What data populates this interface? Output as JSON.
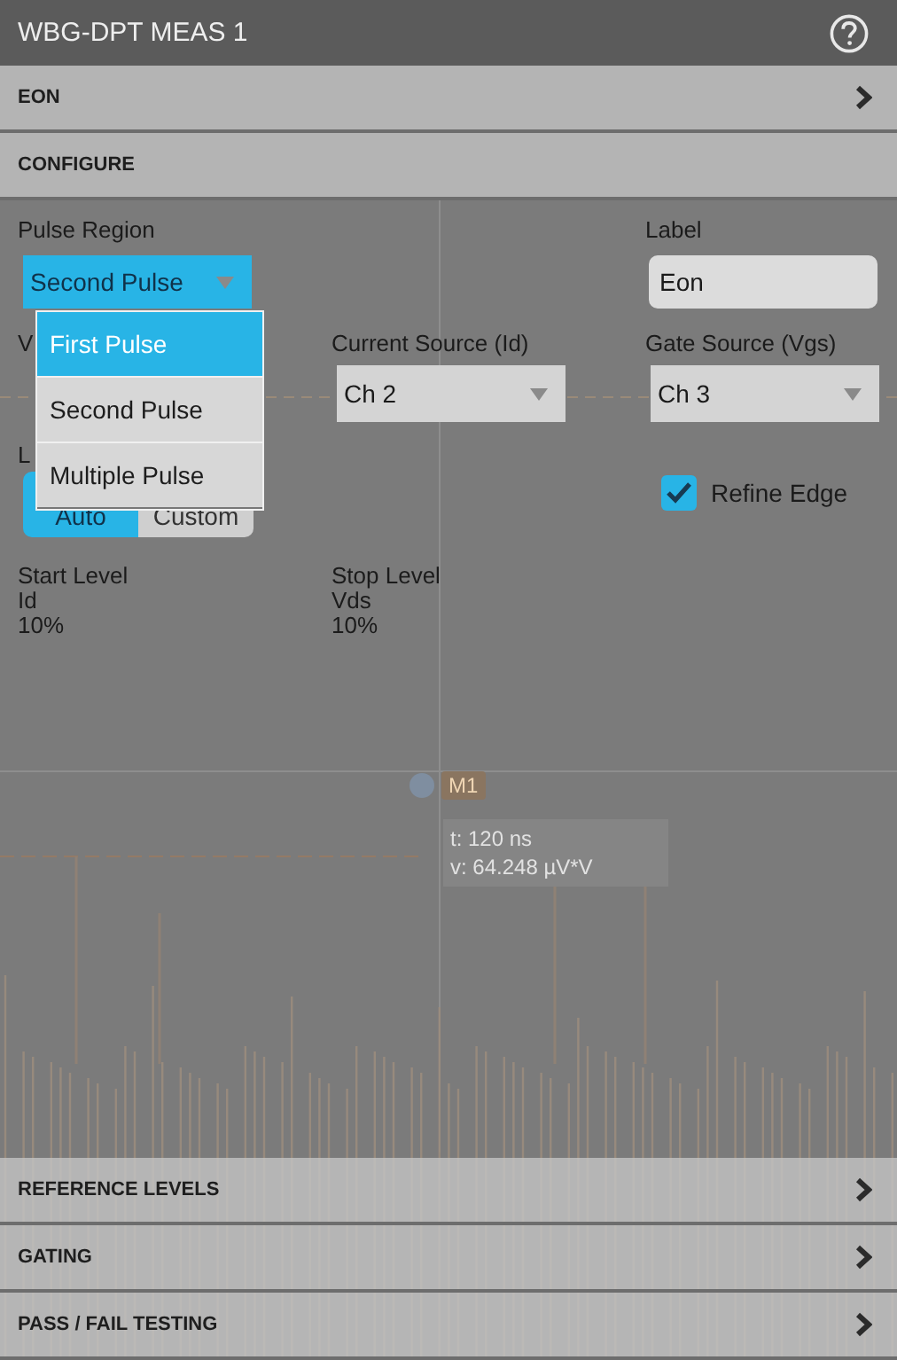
{
  "window": {
    "title": "WBG-DPT MEAS 1"
  },
  "sections_top": [
    {
      "label": "EON",
      "expanded": false
    },
    {
      "label": "CONFIGURE",
      "expanded": true
    }
  ],
  "configure": {
    "pulse_region": {
      "label": "Pulse Region",
      "value": "Second Pulse",
      "open": true,
      "options": [
        {
          "label": "First Pulse",
          "highlighted": true
        },
        {
          "label": "Second Pulse",
          "highlighted": false
        },
        {
          "label": "Multiple Pulse",
          "highlighted": false
        }
      ]
    },
    "label_field": {
      "label": "Label",
      "value": "Eon"
    },
    "voltage_source": {
      "label": "V"
    },
    "current_source": {
      "label": "Current Source (Id)",
      "value": "Ch 2",
      "open": false
    },
    "gate_source": {
      "label": "Gate Source (Vgs)",
      "value": "Ch 3",
      "open": false
    },
    "level_mode": {
      "label": "L",
      "options": [
        {
          "label": "Auto",
          "selected": true
        },
        {
          "label": "Custom",
          "selected": false
        }
      ]
    },
    "refine_edge": {
      "label": "Refine Edge",
      "checked": true
    },
    "levels": [
      {
        "title": "Start Level",
        "source": "Id",
        "value": "10%"
      },
      {
        "title": "Stop Level",
        "source": "Vds",
        "value": "10%"
      }
    ]
  },
  "scope": {
    "marker": "M1",
    "readout": [
      "t: 120 ns",
      "v: 64.248 µV*V"
    ]
  },
  "sections_bottom": [
    {
      "label": "REFERENCE LEVELS",
      "expanded": false
    },
    {
      "label": "GATING",
      "expanded": false
    },
    {
      "label": "PASS / FAIL TESTING",
      "expanded": false
    }
  ]
}
